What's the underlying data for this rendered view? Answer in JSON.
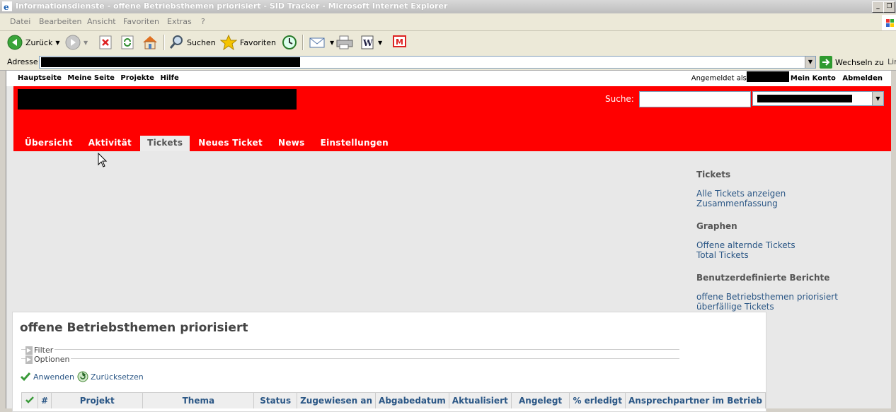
{
  "window": {
    "title": "Informationsdienste - offene Betriebsthemen priorisiert - SID Tracker - Microsoft Internet Explorer",
    "minimize": "_",
    "restore": "❐"
  },
  "menubar": [
    "Datei",
    "Bearbeiten",
    "Ansicht",
    "Favoriten",
    "Extras",
    "?"
  ],
  "toolbar": {
    "back_label": "Zurück",
    "search_label": "Suchen",
    "favorites_label": "Favoriten"
  },
  "addressbar": {
    "label": "Adresse",
    "go_label": "Wechseln zu",
    "links_label": "Lin"
  },
  "topmenu": {
    "items": [
      "Hauptseite",
      "Meine Seite",
      "Projekte",
      "Hilfe"
    ],
    "logged_in_as": "Angemeldet als",
    "my_account": "Mein Konto",
    "logout": "Abmelden"
  },
  "header": {
    "search_label": "Suche:",
    "bg_color": "#ff0000"
  },
  "tabs": [
    {
      "label": "Übersicht",
      "active": false
    },
    {
      "label": "Aktivität",
      "active": false
    },
    {
      "label": "Tickets",
      "active": true
    },
    {
      "label": "Neues Ticket",
      "active": false
    },
    {
      "label": "News",
      "active": false
    },
    {
      "label": "Einstellungen",
      "active": false
    }
  ],
  "sidebar": {
    "tickets_heading": "Tickets",
    "tickets_links": [
      "Alle Tickets anzeigen",
      "Zusammenfassung"
    ],
    "graphs_heading": "Graphen",
    "graphs_links": [
      "Offene alternde Tickets",
      "Total Tickets"
    ],
    "reports_heading": "Benutzerdefinierte Berichte",
    "reports_links": [
      "offene Betriebsthemen priorisiert",
      "überfällige Tickets"
    ]
  },
  "content": {
    "title": "offene Betriebsthemen priorisiert",
    "filter_label": "Filter",
    "options_label": "Optionen",
    "apply_label": "Anwenden",
    "reset_label": "Zurücksetzen"
  },
  "table": {
    "columns": [
      "",
      "#",
      "Projekt",
      "Thema",
      "Status",
      "Zugewiesen an",
      "Abgabedatum",
      "Aktualisiert",
      "Angelegt",
      "% erledigt",
      "Ansprechpartner im Betrieb"
    ]
  }
}
